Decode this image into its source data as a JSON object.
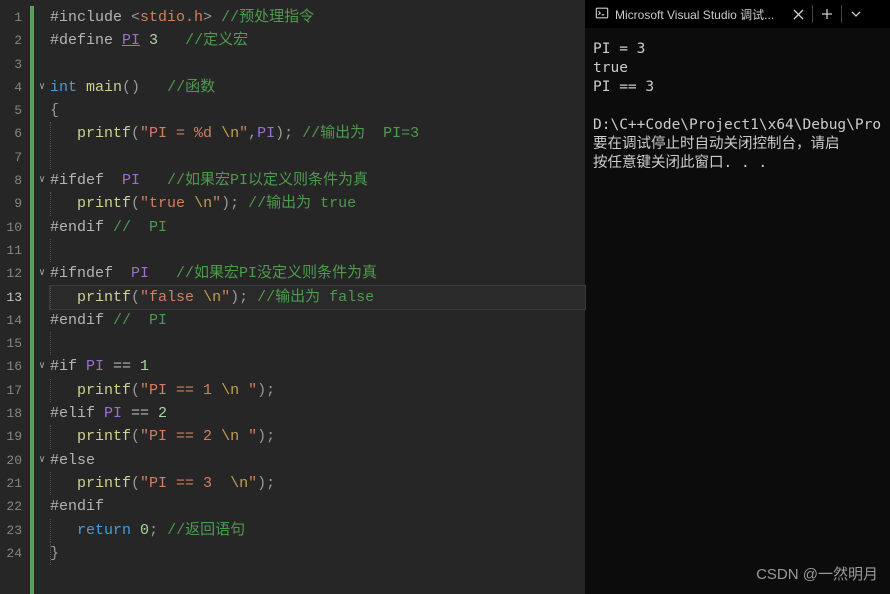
{
  "editor": {
    "active_line": 13,
    "lines": [
      {
        "n": 1,
        "fold": "",
        "indent": 0,
        "tokens": [
          {
            "t": "#include",
            "c": "pp"
          },
          {
            "t": " <",
            "c": "pn"
          },
          {
            "t": "stdio.h",
            "c": "inc"
          },
          {
            "t": "> ",
            "c": "pn"
          },
          {
            "t": "//预处理指令",
            "c": "cmt"
          }
        ]
      },
      {
        "n": 2,
        "fold": "",
        "indent": 0,
        "tokens": [
          {
            "t": "#define ",
            "c": "pp"
          },
          {
            "t": "PI",
            "c": "mac",
            "u": true
          },
          {
            "t": " ",
            "c": ""
          },
          {
            "t": "3",
            "c": "num"
          },
          {
            "t": "   ",
            "c": ""
          },
          {
            "t": "//定义宏",
            "c": "cmt"
          }
        ]
      },
      {
        "n": 3,
        "fold": "",
        "indent": 0,
        "tokens": []
      },
      {
        "n": 4,
        "fold": "v",
        "indent": 0,
        "tokens": [
          {
            "t": "int",
            "c": "kw"
          },
          {
            "t": " ",
            "c": ""
          },
          {
            "t": "main",
            "c": "fn"
          },
          {
            "t": "()   ",
            "c": "pn"
          },
          {
            "t": "//函数",
            "c": "cmt"
          }
        ]
      },
      {
        "n": 5,
        "fold": "",
        "indent": 0,
        "tokens": [
          {
            "t": "{",
            "c": "pn"
          }
        ]
      },
      {
        "n": 6,
        "fold": "",
        "indent": 1,
        "tokens": [
          {
            "t": "   ",
            "c": ""
          },
          {
            "t": "printf",
            "c": "fn"
          },
          {
            "t": "(",
            "c": "pn"
          },
          {
            "t": "\"PI = %d ",
            "c": "str"
          },
          {
            "t": "\\n",
            "c": "esc"
          },
          {
            "t": "\"",
            "c": "str"
          },
          {
            "t": ",",
            "c": "pn"
          },
          {
            "t": "PI",
            "c": "mac"
          },
          {
            "t": "); ",
            "c": "pn"
          },
          {
            "t": "//输出为  PI=3",
            "c": "cmt"
          }
        ]
      },
      {
        "n": 7,
        "fold": "",
        "indent": 1,
        "tokens": []
      },
      {
        "n": 8,
        "fold": "v",
        "indent": 0,
        "tokens": [
          {
            "t": "#ifdef  ",
            "c": "pp"
          },
          {
            "t": "PI",
            "c": "mac"
          },
          {
            "t": "   ",
            "c": ""
          },
          {
            "t": "//如果宏PI以定义则条件为真",
            "c": "cmt"
          }
        ]
      },
      {
        "n": 9,
        "fold": "",
        "indent": 1,
        "tokens": [
          {
            "t": "   ",
            "c": ""
          },
          {
            "t": "printf",
            "c": "fn"
          },
          {
            "t": "(",
            "c": "pn"
          },
          {
            "t": "\"true ",
            "c": "str"
          },
          {
            "t": "\\n",
            "c": "esc"
          },
          {
            "t": "\"",
            "c": "str"
          },
          {
            "t": "); ",
            "c": "pn"
          },
          {
            "t": "//输出为 true",
            "c": "cmt"
          }
        ]
      },
      {
        "n": 10,
        "fold": "",
        "indent": 0,
        "tokens": [
          {
            "t": "#endif",
            "c": "pp"
          },
          {
            "t": " ",
            "c": ""
          },
          {
            "t": "//  PI",
            "c": "cmt"
          }
        ]
      },
      {
        "n": 11,
        "fold": "",
        "indent": 1,
        "tokens": []
      },
      {
        "n": 12,
        "fold": "v",
        "indent": 0,
        "tokens": [
          {
            "t": "#ifndef  ",
            "c": "pp"
          },
          {
            "t": "PI",
            "c": "mac"
          },
          {
            "t": "   ",
            "c": ""
          },
          {
            "t": "//如果宏PI没定义则条件为真",
            "c": "cmt"
          }
        ]
      },
      {
        "n": 13,
        "fold": "",
        "indent": 1,
        "tokens": [
          {
            "t": "   ",
            "c": ""
          },
          {
            "t": "printf",
            "c": "fn"
          },
          {
            "t": "(",
            "c": "pn"
          },
          {
            "t": "\"false ",
            "c": "str"
          },
          {
            "t": "\\n",
            "c": "esc"
          },
          {
            "t": "\"",
            "c": "str"
          },
          {
            "t": "); ",
            "c": "pn"
          },
          {
            "t": "//输出为 false",
            "c": "cmt"
          }
        ]
      },
      {
        "n": 14,
        "fold": "",
        "indent": 0,
        "tokens": [
          {
            "t": "#endif",
            "c": "pp"
          },
          {
            "t": " ",
            "c": ""
          },
          {
            "t": "//  PI",
            "c": "cmt"
          }
        ]
      },
      {
        "n": 15,
        "fold": "",
        "indent": 1,
        "tokens": []
      },
      {
        "n": 16,
        "fold": "v",
        "indent": 0,
        "tokens": [
          {
            "t": "#if ",
            "c": "pp"
          },
          {
            "t": "PI",
            "c": "mac"
          },
          {
            "t": " == ",
            "c": "op"
          },
          {
            "t": "1",
            "c": "num"
          }
        ]
      },
      {
        "n": 17,
        "fold": "",
        "indent": 1,
        "tokens": [
          {
            "t": "   ",
            "c": ""
          },
          {
            "t": "printf",
            "c": "fn"
          },
          {
            "t": "(",
            "c": "pn"
          },
          {
            "t": "\"PI == 1 ",
            "c": "str"
          },
          {
            "t": "\\n",
            "c": "esc"
          },
          {
            "t": " \"",
            "c": "str"
          },
          {
            "t": ");",
            "c": "pn"
          }
        ]
      },
      {
        "n": 18,
        "fold": "",
        "indent": 0,
        "tokens": [
          {
            "t": "#elif ",
            "c": "pp"
          },
          {
            "t": "PI",
            "c": "mac"
          },
          {
            "t": " == ",
            "c": "op"
          },
          {
            "t": "2",
            "c": "num"
          }
        ]
      },
      {
        "n": 19,
        "fold": "",
        "indent": 1,
        "tokens": [
          {
            "t": "   ",
            "c": ""
          },
          {
            "t": "printf",
            "c": "fn"
          },
          {
            "t": "(",
            "c": "pn"
          },
          {
            "t": "\"PI == 2 ",
            "c": "str"
          },
          {
            "t": "\\n",
            "c": "esc"
          },
          {
            "t": " \"",
            "c": "str"
          },
          {
            "t": ");",
            "c": "pn"
          }
        ]
      },
      {
        "n": 20,
        "fold": "v",
        "indent": 0,
        "tokens": [
          {
            "t": "#else",
            "c": "pp"
          }
        ]
      },
      {
        "n": 21,
        "fold": "",
        "indent": 1,
        "tokens": [
          {
            "t": "   ",
            "c": ""
          },
          {
            "t": "printf",
            "c": "fn"
          },
          {
            "t": "(",
            "c": "pn"
          },
          {
            "t": "\"PI == 3  ",
            "c": "str"
          },
          {
            "t": "\\n",
            "c": "esc"
          },
          {
            "t": "\"",
            "c": "str"
          },
          {
            "t": ");",
            "c": "pn"
          }
        ]
      },
      {
        "n": 22,
        "fold": "",
        "indent": 0,
        "tokens": [
          {
            "t": "#endif",
            "c": "pp"
          }
        ]
      },
      {
        "n": 23,
        "fold": "",
        "indent": 1,
        "tokens": [
          {
            "t": "   ",
            "c": ""
          },
          {
            "t": "return",
            "c": "kw"
          },
          {
            "t": " ",
            "c": ""
          },
          {
            "t": "0",
            "c": "num"
          },
          {
            "t": "; ",
            "c": "pn"
          },
          {
            "t": "//返回语句",
            "c": "cmt"
          }
        ]
      },
      {
        "n": 24,
        "fold": "",
        "indent": 1,
        "tokens": [
          {
            "t": "}",
            "c": "pn"
          }
        ]
      }
    ]
  },
  "terminal": {
    "tab_title": "Microsoft Visual Studio 调试...",
    "output": "PI = 3\ntrue\nPI == 3\n\nD:\\C++Code\\Project1\\x64\\Debug\\Pro\n要在调试停止时自动关闭控制台，请启\n按任意键关闭此窗口. . ."
  },
  "watermark": "CSDN @一然明月"
}
